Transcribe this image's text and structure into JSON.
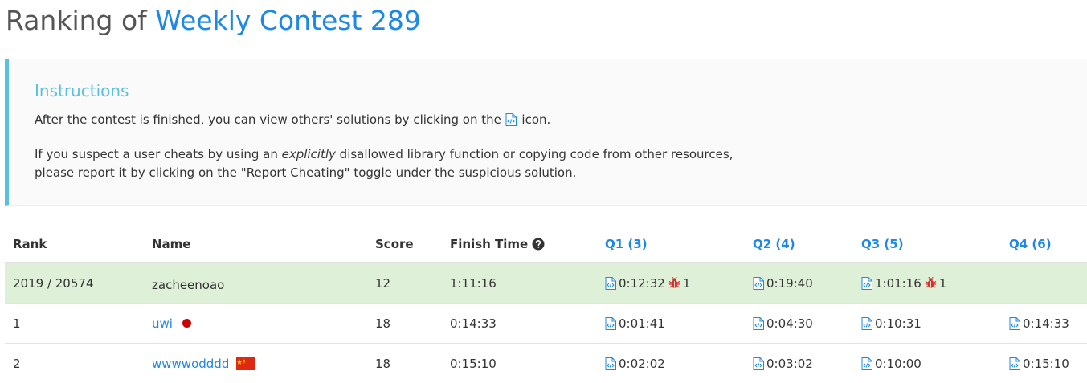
{
  "header": {
    "title_prefix": "Ranking of ",
    "contest_name": "Weekly Contest 289"
  },
  "instructions": {
    "heading": "Instructions",
    "line1_before": "After the contest is finished, you can view others' solutions by clicking on the ",
    "line1_after": " icon.",
    "line2_before": "If you suspect a user cheats by using an ",
    "line2_em": "explicitly",
    "line2_after": " disallowed library function or copying code from other resources,",
    "line3": "please report it by clicking on the \"Report Cheating\" toggle under the suspicious solution."
  },
  "table": {
    "columns": {
      "rank": "Rank",
      "name": "Name",
      "score": "Score",
      "finish": "Finish Time",
      "q1": "Q1 (3)",
      "q2": "Q2 (4)",
      "q3": "Q3 (5)",
      "q4": "Q4 (6)"
    },
    "me": {
      "rank": "2019 / 20574",
      "name": "zacheenoao",
      "score": "12",
      "finish": "1:11:16",
      "q1": {
        "time": "0:12:32",
        "bugs": "1"
      },
      "q2": {
        "time": "0:19:40"
      },
      "q3": {
        "time": "1:01:16",
        "bugs": "1"
      }
    },
    "rows": [
      {
        "rank": "1",
        "name": "uwi",
        "score": "18",
        "finish": "0:14:33",
        "q1": "0:01:41",
        "q2": "0:04:30",
        "q3": "0:10:31",
        "q4": "0:14:33"
      },
      {
        "rank": "2",
        "name": "wwwwodddd",
        "score": "18",
        "finish": "0:15:10",
        "q1": "0:02:02",
        "q2": "0:03:02",
        "q3": "0:10:00",
        "q4": "0:15:10"
      }
    ]
  },
  "icons": {
    "code": "code-file-icon",
    "bug": "bug-icon",
    "help": "question-circle-icon",
    "flag_japan": "japan-flag-icon",
    "flag_china": "china-flag-icon"
  },
  "colors": {
    "link": "#1e88e5",
    "info": "#5bc0de",
    "me_row": "#dff0d8",
    "bug": "#d32f2f"
  }
}
